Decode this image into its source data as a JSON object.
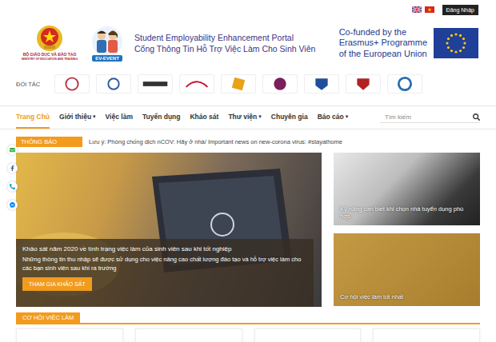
{
  "top_bar": {
    "flags": [
      {
        "kind": "uk"
      },
      {
        "kind": "vn"
      }
    ],
    "login_button": "Đăng Nhập"
  },
  "header": {
    "ministry_name": "BỘ GIÁO DỤC VÀ ĐÀO TẠO",
    "ministry_name_en": "MINISTRY OF EDUCATION AND TRAINING",
    "project_logo": "EV-EVENT",
    "title_en": "Student Employability Enhancement Portal",
    "title_vi": "Cổng Thông Tin Hỗ Trợ Việc Làm Cho Sinh Viên",
    "erasmus_lines": [
      "Co-funded by the",
      "Erasmus+ Programme",
      "of the European Union"
    ]
  },
  "partners": {
    "label": "ĐỐI TÁC",
    "logos": [
      {
        "color": "#b3343a"
      },
      {
        "color": "#2c5aa0"
      },
      {
        "color": "#333333"
      },
      {
        "color": "#c8102e"
      },
      {
        "color": "#e8a317"
      },
      {
        "color": "#7a1f5c"
      },
      {
        "color": "#1f4e9c"
      },
      {
        "color": "#b22222"
      },
      {
        "color": "#2a6fb0"
      }
    ]
  },
  "nav": {
    "caret": "▾",
    "items": [
      {
        "label": "Trang Chủ",
        "selected": true,
        "expandable": false
      },
      {
        "label": "Giới thiệu",
        "selected": false,
        "expandable": true
      },
      {
        "label": "Việc làm",
        "selected": false,
        "expandable": false
      },
      {
        "label": "Tuyển dụng",
        "selected": false,
        "expandable": false
      },
      {
        "label": "Khảo sát",
        "selected": false,
        "expandable": false
      },
      {
        "label": "Thư viện",
        "selected": false,
        "expandable": true
      },
      {
        "label": "Chuyên gia",
        "selected": false,
        "expandable": false
      },
      {
        "label": "Báo cáo",
        "selected": false,
        "expandable": true
      }
    ]
  },
  "search": {
    "placeholder": "Tìm kiếm"
  },
  "notice": {
    "label": "THÔNG BÁO",
    "text": "Lưu ý: Phòng chống dịch nCOV: Hãy ở nhà/ Important news on new-corona virus: #stayathome"
  },
  "social": [
    {
      "kind": "mail",
      "color": "#3bb54a"
    },
    {
      "kind": "facebook",
      "color": "#3b5998"
    },
    {
      "kind": "phone",
      "color": "#1a9fd8"
    },
    {
      "kind": "messenger",
      "color": "#0084ff"
    }
  ],
  "hero": {
    "title": "Khảo sát năm 2020 về tình trạng việc làm của sinh viên sau khi tốt nghiệp",
    "text": "Những thông tin thu nhập sẽ được sử dụng cho việc nâng cao chất lượng đào tạo và hỗ trợ việc làm cho các bạn sinh viên sau khi ra trường",
    "button": "THAM GIA KHẢO SÁT"
  },
  "side_cards": [
    {
      "kind": "handshake",
      "caption": "Kỹ năng cần biết khi chọn nhà tuyển dụng phù hợp"
    },
    {
      "kind": "job",
      "caption": "Cơ hội việc làm tốt nhất"
    }
  ],
  "jobs": {
    "title": "CƠ HỘI VIỆC LÀM",
    "cards": [
      {
        "kind": "placeholder"
      },
      {
        "kind": "placeholder"
      },
      {
        "kind": "placeholder"
      },
      {
        "kind": "placeholder"
      }
    ]
  }
}
